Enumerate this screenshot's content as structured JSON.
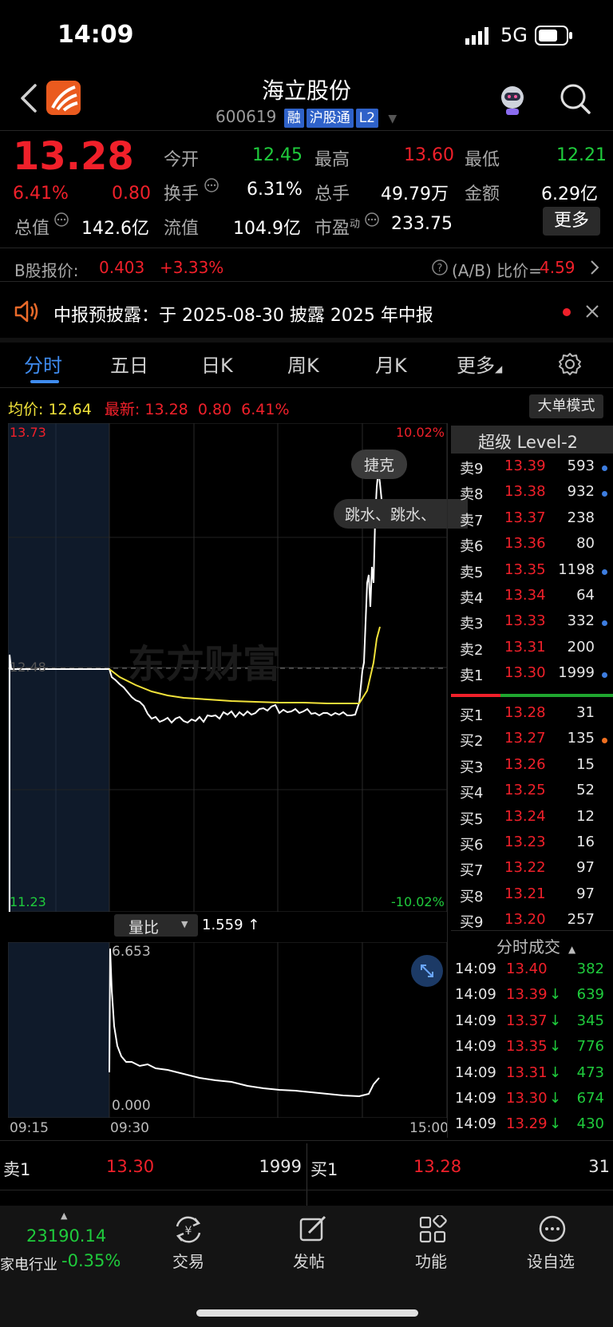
{
  "status": {
    "time": "14:09",
    "network": "5G"
  },
  "header": {
    "title": "海立股份",
    "code": "600619",
    "tags": [
      "融",
      "沪股通",
      "L2"
    ]
  },
  "quote": {
    "price": "13.28",
    "change_pct": "6.41%",
    "change": "0.80",
    "open_label": "今开",
    "open": "12.45",
    "high_label": "最高",
    "high": "13.60",
    "low_label": "最低",
    "low": "12.21",
    "turnover_label": "换手",
    "turnover": "6.31%",
    "volume_label": "总手",
    "volume": "49.79万",
    "amount_label": "金额",
    "amount": "6.29亿",
    "mktcap_label": "总值",
    "mktcap": "142.6亿",
    "float_label": "流值",
    "float": "104.9亿",
    "pe_label": "市盈",
    "pe_sup": "动",
    "pe": "233.75",
    "more_button": "更多"
  },
  "bshare": {
    "label": "B股报价:",
    "price": "0.403",
    "pct": "+3.33%",
    "ratio_label": "(A/B) 比价=",
    "ratio": "4.59"
  },
  "notice": {
    "text": "中报预披露：于 2025-08-30 披露 2025 年中报"
  },
  "tabs": [
    "分时",
    "五日",
    "日K",
    "周K",
    "月K",
    "更多"
  ],
  "info_bar": {
    "avg_label": "均价:",
    "avg": "12.64",
    "latest_label": "最新:",
    "latest": "13.28",
    "chg": "0.80",
    "pct": "6.41%",
    "mode_button": "大单模式"
  },
  "chart_labels": {
    "top_price": "13.73",
    "bottom_price": "11.23",
    "top_pct": "10.02%",
    "bottom_pct": "-10.02%",
    "mid_price": "12.48",
    "bubble1": "捷克",
    "bubble2": "跳水、跳水、",
    "watermark": "东方财富"
  },
  "volume_panel": {
    "indicator": "量比",
    "value": "1.559 ↑",
    "max": "6.653",
    "min": "0.000"
  },
  "time_axis": [
    "09:15",
    "09:30",
    "15:00"
  ],
  "level2_title": "超级 Level-2",
  "asks": [
    {
      "label": "卖9",
      "price": "13.39",
      "vol": "593",
      "dot": "blue"
    },
    {
      "label": "卖8",
      "price": "13.38",
      "vol": "932",
      "dot": "blue"
    },
    {
      "label": "卖7",
      "price": "13.37",
      "vol": "238",
      "dot": ""
    },
    {
      "label": "卖6",
      "price": "13.36",
      "vol": "80",
      "dot": ""
    },
    {
      "label": "卖5",
      "price": "13.35",
      "vol": "1198",
      "dot": "blue"
    },
    {
      "label": "卖4",
      "price": "13.34",
      "vol": "64",
      "dot": ""
    },
    {
      "label": "卖3",
      "price": "13.33",
      "vol": "332",
      "dot": "blue"
    },
    {
      "label": "卖2",
      "price": "13.31",
      "vol": "200",
      "dot": ""
    },
    {
      "label": "卖1",
      "price": "13.30",
      "vol": "1999",
      "dot": "blue"
    }
  ],
  "bids": [
    {
      "label": "买1",
      "price": "13.28",
      "vol": "31",
      "dot": ""
    },
    {
      "label": "买2",
      "price": "13.27",
      "vol": "135",
      "dot": "orange"
    },
    {
      "label": "买3",
      "price": "13.26",
      "vol": "15",
      "dot": ""
    },
    {
      "label": "买4",
      "price": "13.25",
      "vol": "52",
      "dot": ""
    },
    {
      "label": "买5",
      "price": "13.24",
      "vol": "12",
      "dot": ""
    },
    {
      "label": "买6",
      "price": "13.23",
      "vol": "16",
      "dot": ""
    },
    {
      "label": "买7",
      "price": "13.22",
      "vol": "97",
      "dot": ""
    },
    {
      "label": "买8",
      "price": "13.21",
      "vol": "97",
      "dot": ""
    },
    {
      "label": "买9",
      "price": "13.20",
      "vol": "257",
      "dot": ""
    }
  ],
  "ticks_title": "分时成交",
  "ticks": [
    {
      "time": "14:09",
      "price": "13.40",
      "arrow": "",
      "vol": "382"
    },
    {
      "time": "14:09",
      "price": "13.39",
      "arrow": "↓",
      "vol": "639"
    },
    {
      "time": "14:09",
      "price": "13.37",
      "arrow": "↓",
      "vol": "345"
    },
    {
      "time": "14:09",
      "price": "13.35",
      "arrow": "↓",
      "vol": "776"
    },
    {
      "time": "14:09",
      "price": "13.31",
      "arrow": "↓",
      "vol": "473"
    },
    {
      "time": "14:09",
      "price": "13.30",
      "arrow": "↓",
      "vol": "674"
    },
    {
      "time": "14:09",
      "price": "13.29",
      "arrow": "↓",
      "vol": "430"
    }
  ],
  "bottom_quote": {
    "sell_label": "卖1",
    "sell_price": "13.30",
    "sell_vol": "1999",
    "buy_label": "买1",
    "buy_price": "13.28",
    "buy_vol": "31"
  },
  "index": {
    "value": "23190.14",
    "name": "家电行业",
    "pct": "-0.35%"
  },
  "nav": [
    "交易",
    "发帖",
    "功能",
    "设自选"
  ]
}
